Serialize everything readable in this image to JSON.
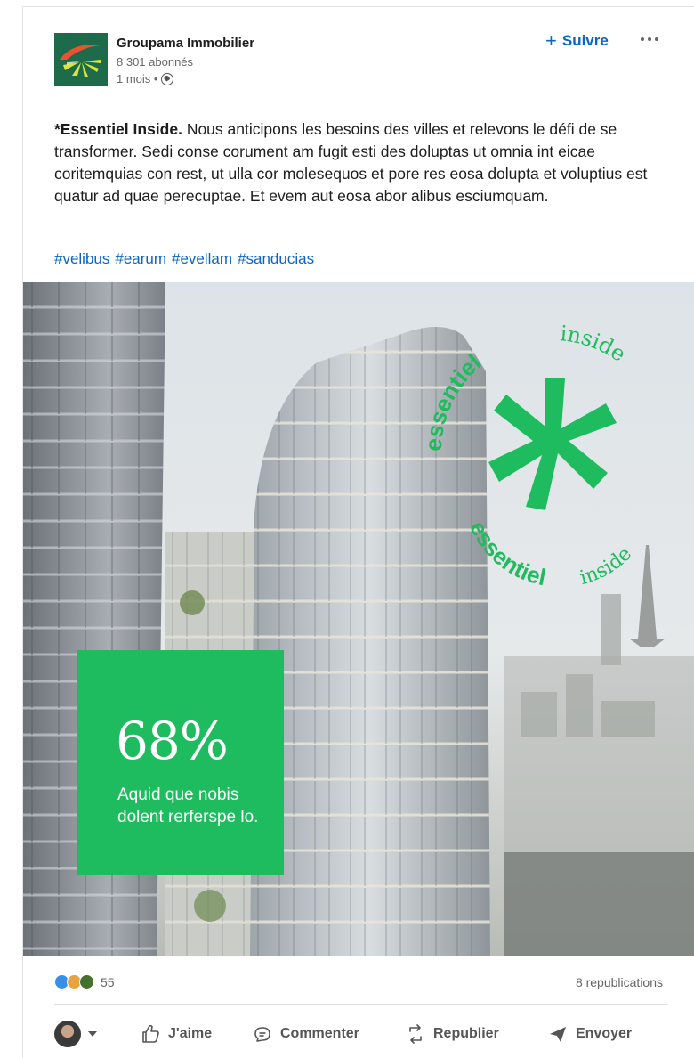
{
  "post": {
    "company_name": "Groupama Immobilier",
    "followers": "8 301 abonnés",
    "time": "1 mois •",
    "follow_label": "Suivre",
    "text_strong": "*Essentiel Inside.",
    "text_body": " Nous anticipons les besoins des villes et relevons le défi de se transformer. Sedi conse corument am fugit esti des doluptas ut omnia int eicae coritemquias con rest, ut ulla cor molesequos et pore res eosa dolupta et voluptius est quatur ad quae perecuptae. Et evem aut eosa abor alibus esciumquam.",
    "hashtags": [
      "#velibus",
      "#earum",
      "#evellam",
      "#sanducias"
    ]
  },
  "image": {
    "badge_word_1": "essentiel",
    "badge_word_2": "inside",
    "stat_value": "68%",
    "stat_caption": "Aquid que nobis dolent rerferspe lo.",
    "accent_color": "#1ebc5e"
  },
  "social": {
    "reaction_count": "55",
    "republications": "8 republications"
  },
  "actions": {
    "like": "J'aime",
    "comment": "Commenter",
    "repost": "Republier",
    "send": "Envoyer"
  },
  "colors": {
    "link": "#0a66c2",
    "brand_green": "#1d6b4a"
  }
}
